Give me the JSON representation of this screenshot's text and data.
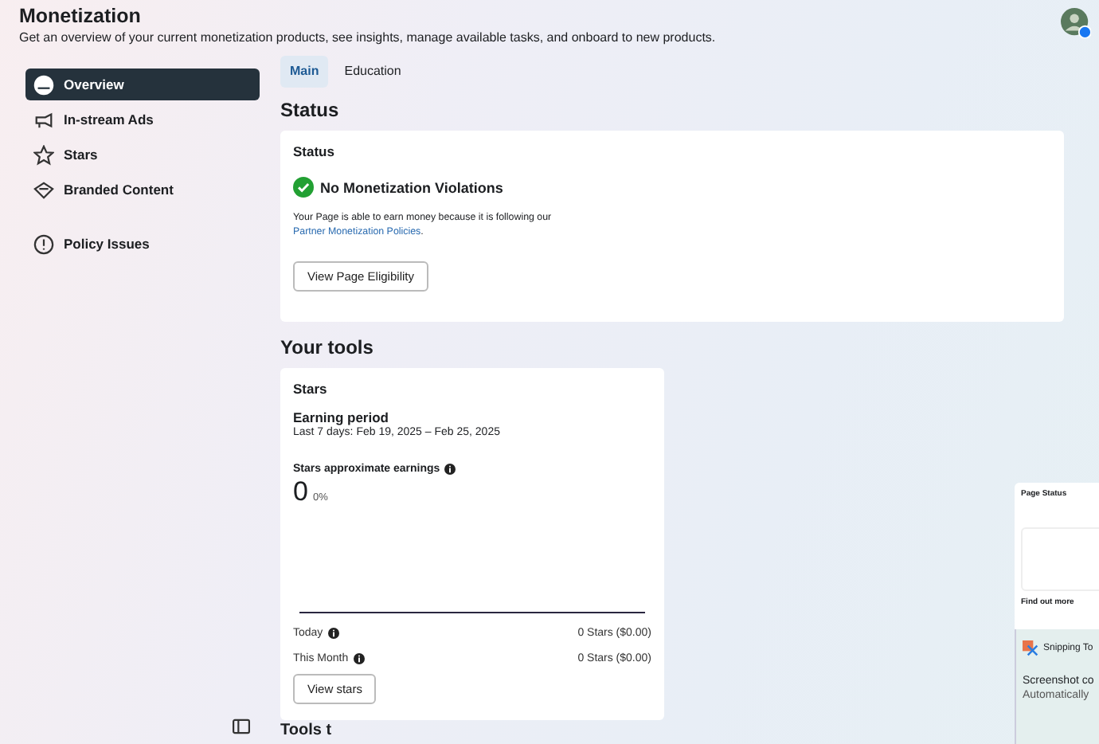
{
  "header": {
    "title": "Monetization",
    "subtitle": "Get an overview of your current monetization products, see insights, manage available tasks, and onboard to new products."
  },
  "sidebar": {
    "items": [
      {
        "label": "Overview",
        "kind": "overview",
        "selected": true
      },
      {
        "label": "In-stream Ads",
        "kind": "ads",
        "selected": false
      },
      {
        "label": "Stars",
        "kind": "stars",
        "selected": false
      },
      {
        "label": "Branded Content",
        "kind": "branded",
        "selected": false
      }
    ],
    "footer_items": [
      {
        "label": "Policy Issues",
        "kind": "policy",
        "selected": false
      }
    ]
  },
  "tabs": [
    {
      "label": "Main",
      "selected": true
    },
    {
      "label": "Education",
      "selected": false
    }
  ],
  "status": {
    "heading": "Status",
    "card_title": "Status",
    "result": "No Monetization Violations",
    "text": "Your Page is able to earn money because it is following our",
    "link": "Partner Monetization Policies",
    "link_suffix": ".",
    "button": "View Page Eligibility"
  },
  "tools": {
    "heading": "Your tools",
    "card": {
      "title": "Stars",
      "period_title": "Earning period",
      "period": "Last 7 days: Feb 19, 2025 – Feb 25, 2025",
      "earnings_label": "Stars approximate earnings",
      "earnings_value": "0",
      "earnings_change": "0%",
      "rows": [
        {
          "label": "Today",
          "value": "0 Stars ($0.00)"
        },
        {
          "label": "This Month",
          "value": "0 Stars ($0.00)"
        }
      ],
      "button": "View stars"
    }
  },
  "next_heading": "Tools t",
  "overlay": {
    "panel_title": "Page Status",
    "panel_section": "Find out more",
    "notification_app": "Snipping To",
    "notification_title": "Screenshot co",
    "notification_text": "Automatically"
  }
}
